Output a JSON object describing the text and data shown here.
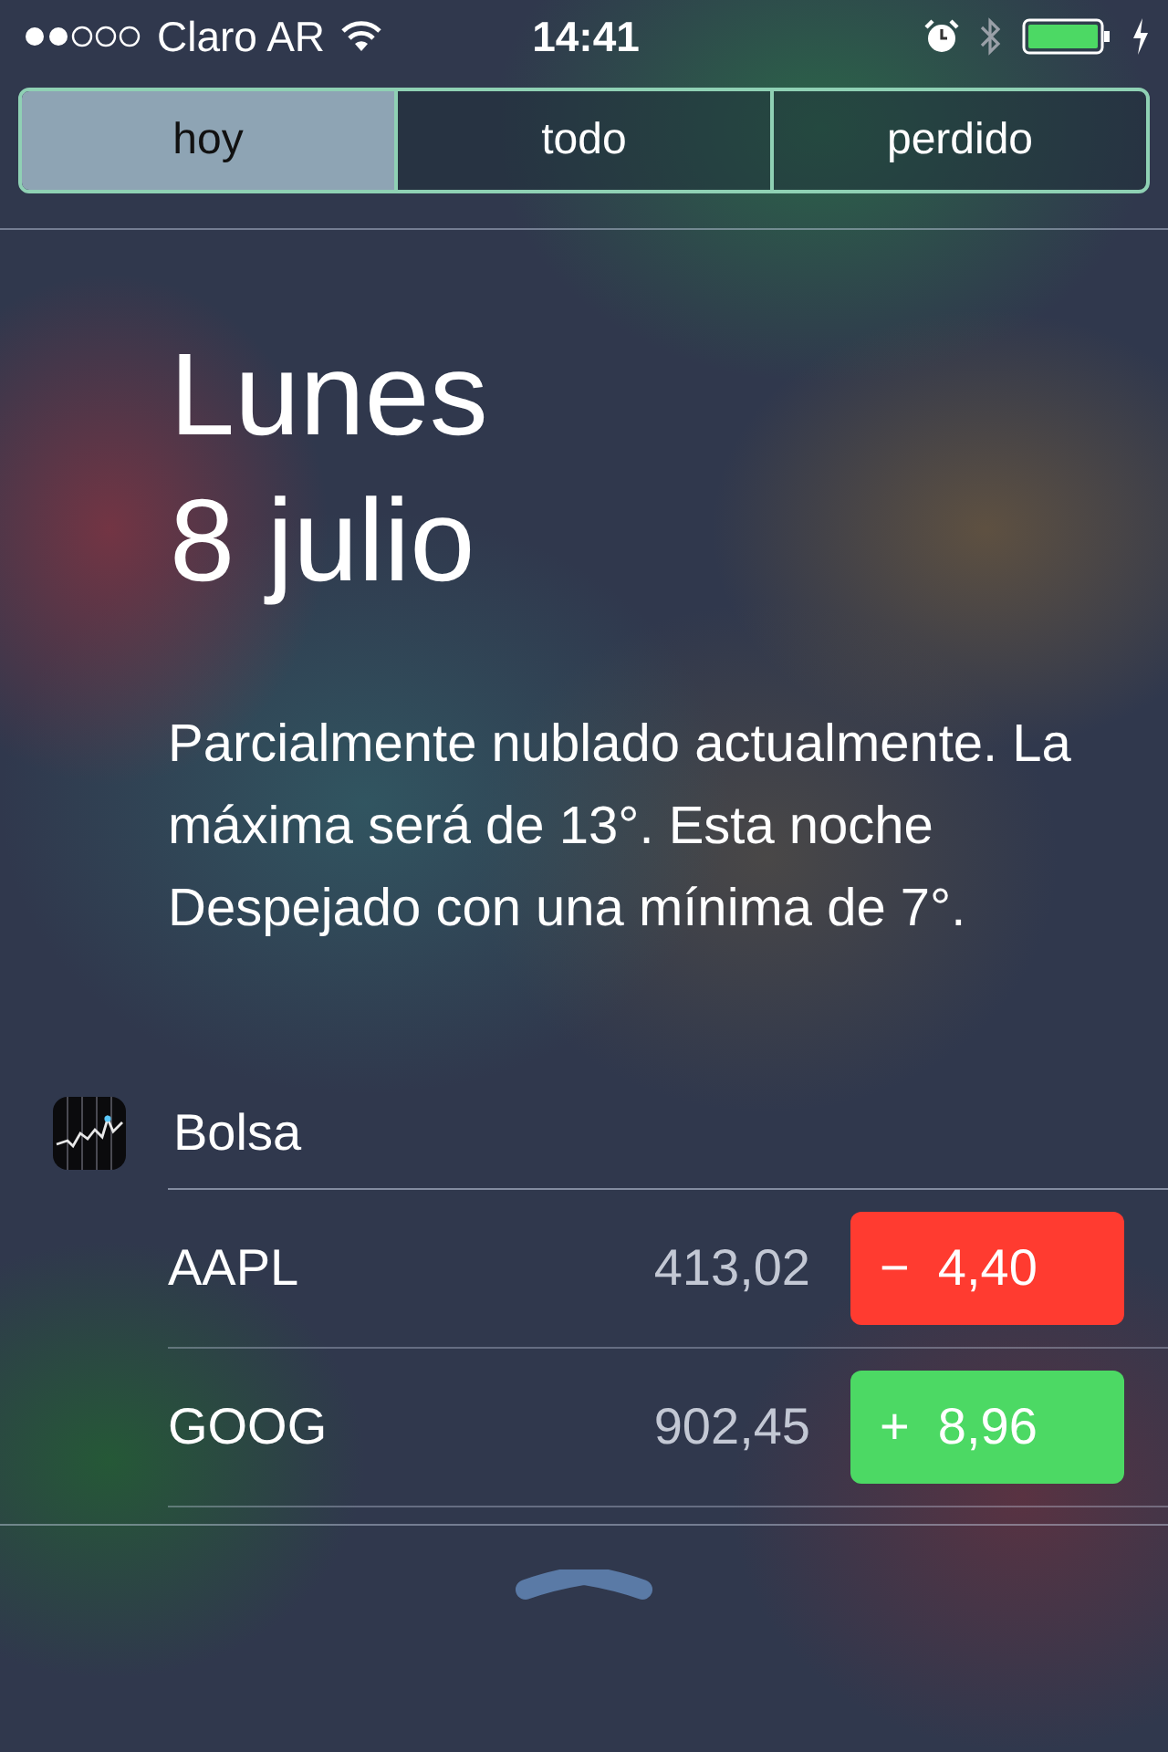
{
  "status_bar": {
    "carrier": "Claro AR",
    "time": "14:41"
  },
  "tabs": [
    {
      "label": "hoy",
      "selected": true
    },
    {
      "label": "todo",
      "selected": false
    },
    {
      "label": "perdido",
      "selected": false
    }
  ],
  "date": {
    "weekday": "Lunes",
    "day": "8 julio"
  },
  "weather_summary": "Parcialmente nublado actualmente. La máxima será de 13°. Esta noche Despejado con una mínima de 7°.",
  "stocks": {
    "title": "Bolsa",
    "rows": [
      {
        "symbol": "AAPL",
        "price": "413,02",
        "change": "−  4,40",
        "kind": "down"
      },
      {
        "symbol": "GOOG",
        "price": "902,45",
        "change": "+  8,96",
        "kind": "up"
      }
    ]
  }
}
